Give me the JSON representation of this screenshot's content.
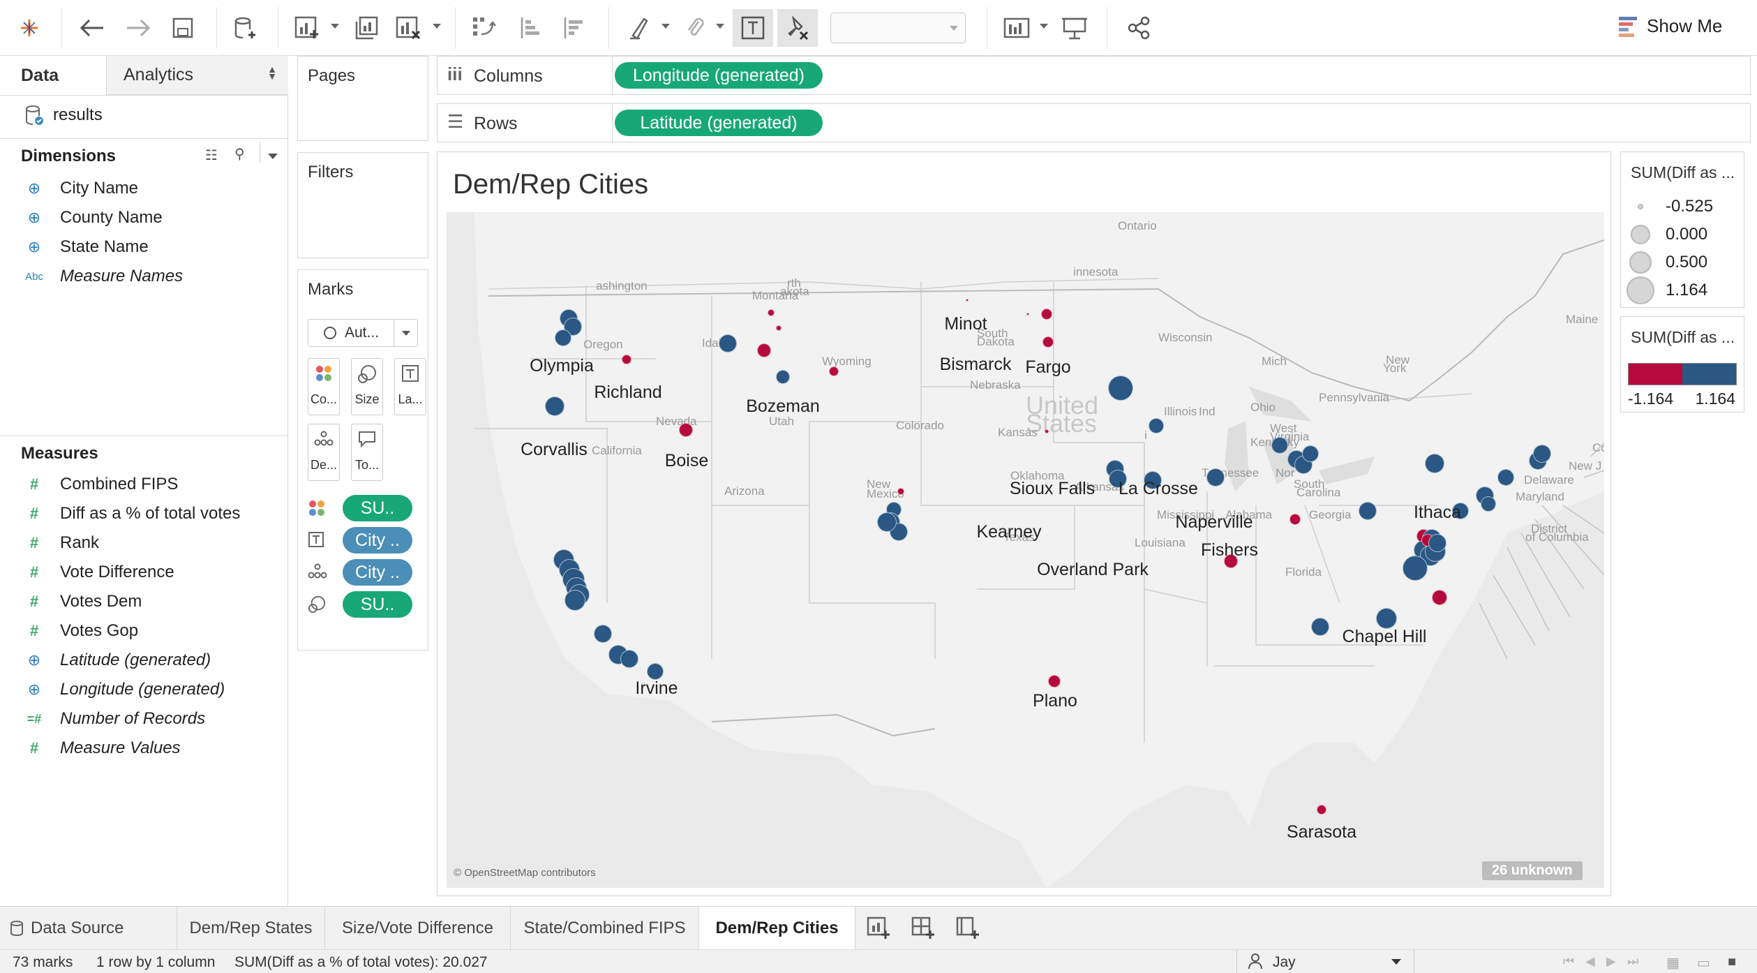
{
  "toolbar": {
    "icons": [
      "tableau-logo-icon",
      "back-icon",
      "forward-icon",
      "save-icon",
      "new-data-source-icon",
      "new-worksheet-icon",
      "duplicate-sheet-icon",
      "clear-sheet-icon",
      "swap-rows-columns-icon",
      "sort-ascending-icon",
      "sort-descending-icon",
      "highlight-icon",
      "group-icon",
      "show-labels-icon",
      "fix-axes-icon",
      "fit-dropdown",
      "show-cards-icon",
      "presentation-mode-icon",
      "share-icon"
    ],
    "show_me": "Show Me"
  },
  "left_pane": {
    "tab_data": "Data",
    "tab_analytics": "Analytics",
    "data_source": "results",
    "dimensions_header": "Dimensions",
    "dimensions": [
      {
        "label": "City Name",
        "icon": "globe"
      },
      {
        "label": "County Name",
        "icon": "globe"
      },
      {
        "label": "State Name",
        "icon": "globe"
      },
      {
        "label": "Measure Names",
        "icon": "Abc"
      }
    ],
    "measures_header": "Measures",
    "measures": [
      {
        "label": "Combined FIPS",
        "icon": "#"
      },
      {
        "label": "Diff as a % of total votes",
        "icon": "#"
      },
      {
        "label": "Rank",
        "icon": "#"
      },
      {
        "label": "Vote Difference",
        "icon": "#"
      },
      {
        "label": "Votes Dem",
        "icon": "#"
      },
      {
        "label": "Votes Gop",
        "icon": "#"
      },
      {
        "label": "Latitude (generated)",
        "icon": "globe"
      },
      {
        "label": "Longitude (generated)",
        "icon": "globe"
      },
      {
        "label": "Number of Records",
        "icon": "=#"
      },
      {
        "label": "Measure Values",
        "icon": "#"
      }
    ]
  },
  "cards": {
    "pages": "Pages",
    "filters": "Filters",
    "marks": "Marks",
    "mark_type": "Aut...",
    "mark_buttons": [
      "Co...",
      "Size",
      "La...",
      "De...",
      "To..."
    ],
    "mark_pills": [
      "SU..",
      "City ..",
      "City ..",
      "SU.."
    ]
  },
  "shelves": {
    "columns_label": "Columns",
    "columns_pill": "Longitude (generated)",
    "rows_label": "Rows",
    "rows_pill": "Latitude (generated)"
  },
  "view": {
    "title": "Dem/Rep Cities",
    "attribution": "© OpenStreetMap contributors",
    "unknown_badge": "26 unknown",
    "map_labels": [
      "Ontario",
      "ashington",
      "Montana",
      "rth",
      "akota",
      "innesota",
      "Wisconsin",
      "South",
      "Dakota",
      "Oregon",
      "Idaho",
      "Wyoming",
      "Mich",
      "New",
      "York",
      "Pennsylvania",
      "Nebraska",
      "United",
      "States",
      "Kansas",
      "Illinois",
      "Ind",
      "Ohio",
      "West",
      "Virginia",
      "Kentucky",
      "Nevada",
      "Utah",
      "Colorado",
      "California",
      "Oklahoma",
      "Arkansas",
      "Tennessee",
      "Nor",
      "South",
      "Carolina",
      "Arizona",
      "New",
      "Mexico",
      "Texas",
      "Louisiana",
      "Mississippi",
      "Alabama",
      "Georgia",
      "Florida",
      "Maine",
      "Con",
      "New J",
      "Delaware",
      "Maryland",
      "District",
      "of Columbia",
      "i"
    ],
    "city_labels": [
      "Minot",
      "Olympia",
      "Richland",
      "Bismarck",
      "Fargo",
      "Bozeman",
      "Corvallis",
      "Boise",
      "Sioux Falls",
      "La Crosse",
      "Naperville",
      "Ithaca",
      "Kearney",
      "Fishers",
      "Overland Park",
      "Chapel Hill",
      "Irvine",
      "Plano",
      "Sarasota"
    ]
  },
  "legends": {
    "size_title": "SUM(Diff as ...",
    "size_values": [
      "-0.525",
      "0.000",
      "0.500",
      "1.164"
    ],
    "color_title": "SUM(Diff as ...",
    "color_min": "-1.164",
    "color_max": "1.164",
    "color_dem": "#2a5783",
    "color_rep": "#b60a3c"
  },
  "tabs": {
    "data_source": "Data Source",
    "sheets": [
      "Dem/Rep States",
      "Size/Vote Difference",
      "State/Combined FIPS",
      "Dem/Rep Cities"
    ],
    "active": "Dem/Rep Cities"
  },
  "status": {
    "marks": "73 marks",
    "rows": "1 row by 1 column",
    "sum": "SUM(Diff as a % of total votes): 20.027",
    "user": "Jay"
  }
}
